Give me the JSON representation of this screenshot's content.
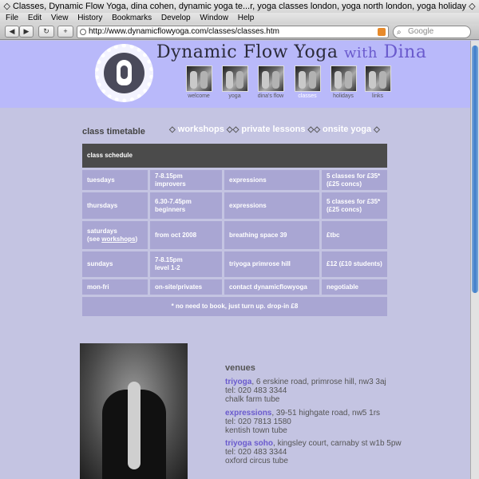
{
  "browser": {
    "title": "◇ Classes, Dynamic Flow Yoga, dina cohen, dynamic yoga te...r, yoga classes london, yoga north london, yoga holiday ◇",
    "menu": [
      "File",
      "Edit",
      "View",
      "History",
      "Bookmarks",
      "Develop",
      "Window",
      "Help"
    ],
    "url": "http://www.dynamicflowyoga.com/classes/classes.htm",
    "search_placeholder": "Google"
  },
  "site": {
    "title": "Dynamic Flow Yoga",
    "with": "with",
    "name": "Dina"
  },
  "nav": [
    {
      "label": "welcome"
    },
    {
      "label": "yoga"
    },
    {
      "label": "dina's flow"
    },
    {
      "label": "classes",
      "active": true
    },
    {
      "label": "holidays"
    },
    {
      "label": "links"
    }
  ],
  "timetable": {
    "heading": "class timetable",
    "links": [
      "workshops",
      "private lessons",
      "onsite yoga"
    ],
    "schedule_header": "class schedule",
    "rows": [
      {
        "day": "tuesdays",
        "time": "7-8.15pm",
        "level": "improvers",
        "venue": "expressions",
        "price": "5 classes for £35*",
        "price2": "(£25 concs)"
      },
      {
        "day": "thursdays",
        "time": "6.30-7.45pm",
        "level": "beginners",
        "venue": "expressions",
        "price": "5 classes for £35*",
        "price2": "(£25 concs)"
      },
      {
        "day": "saturdays",
        "day_note_prefix": "(see ",
        "day_note_link": "workshops",
        "day_note_suffix": ")",
        "time": "from oct 2008",
        "level": "",
        "venue": "breathing space 39",
        "price": "£tbc",
        "price2": ""
      },
      {
        "day": "sundays",
        "time": "7-8.15pm",
        "level": "level 1-2",
        "venue": "triyoga primrose hill",
        "price": "£12 (£10 students)",
        "price2": ""
      },
      {
        "day": "mon-fri",
        "time": "on-site/privates",
        "level": "",
        "venue": "contact dynamicflowyoga",
        "price": "negotiable",
        "price2": ""
      }
    ],
    "note": "* no need to book, just turn up.  drop-in £8"
  },
  "venues": {
    "title": "venues",
    "items": [
      {
        "name": "triyoga",
        "address": ", 6 erskine road, primrose hill, nw3 3aj",
        "tel": "tel: 020 483 3344",
        "tube": "chalk farm tube"
      },
      {
        "name": "expressions",
        "address": ", 39-51 highgate road, nw5 1rs",
        "tel": "tel: 020 7813 1580",
        "tube": "kentish town tube"
      },
      {
        "name": "triyoga soho",
        "address": ", kingsley court, carnaby st w1b 5pw",
        "tel": "tel: 020 483 3344",
        "tube": "oxford circus tube"
      }
    ]
  },
  "colors": {
    "page_bg": "#c4c4e2",
    "header_bg": "#b9b9fa",
    "cell_bg": "#a9a6d3",
    "schedule_header_bg": "#4b4b4b",
    "accent": "#6a5acd"
  }
}
